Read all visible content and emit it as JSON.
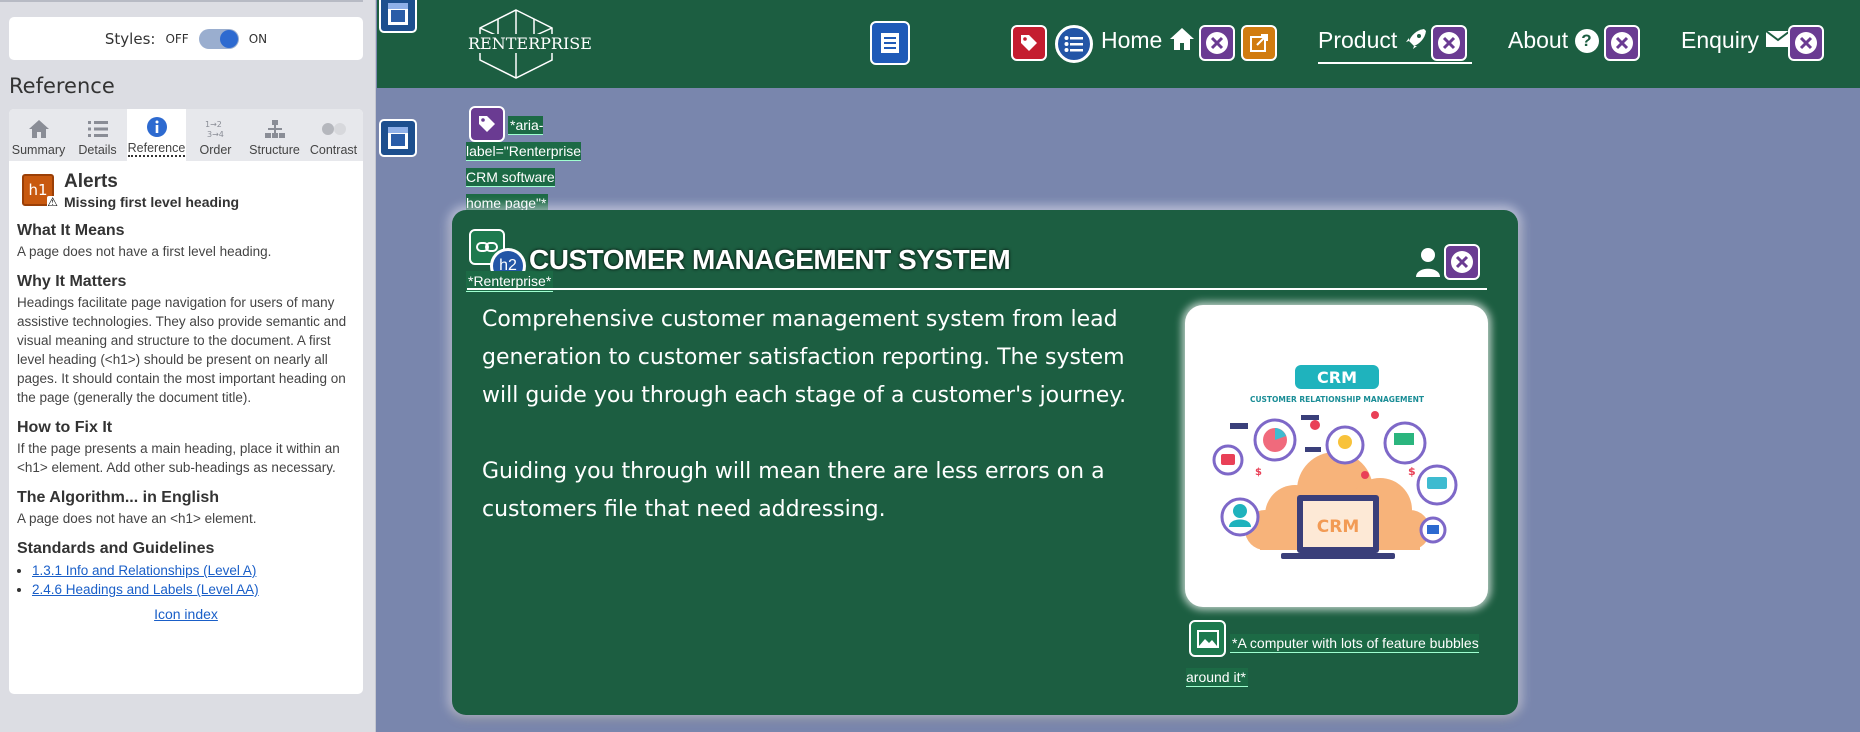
{
  "panel": {
    "styles_label": "Styles:",
    "styles_off": "OFF",
    "styles_on": "ON",
    "reference_heading": "Reference",
    "tabs": [
      {
        "label": "Summary",
        "icon": "home-icon"
      },
      {
        "label": "Details",
        "icon": "list-icon"
      },
      {
        "label": "Reference",
        "icon": "info-icon",
        "active": true
      },
      {
        "label": "Order",
        "icon": "order-icon"
      },
      {
        "label": "Structure",
        "icon": "structure-icon"
      },
      {
        "label": "Contrast",
        "icon": "contrast-icon"
      }
    ],
    "alert": {
      "badge": "h1",
      "title": "Alerts",
      "subtitle": "Missing first level heading"
    },
    "sections": [
      {
        "heading": "What It Means",
        "text": "A page does not have a first level heading."
      },
      {
        "heading": "Why It Matters",
        "text": "Headings facilitate page navigation for users of many assistive technologies. They also provide semantic and visual meaning and structure to the document. A first level heading (<h1>) should be present on nearly all pages. It should contain the most important heading on the page (generally the document title)."
      },
      {
        "heading": "How to Fix It",
        "text": "If the page presents a main heading, place it within an <h1> element. Add other sub-headings as necessary."
      },
      {
        "heading": "The Algorithm... in English",
        "text": "A page does not have an <h1> element."
      }
    ],
    "standards_heading": "Standards and Guidelines",
    "standards": [
      "1.3.1 Info and Relationships (Level A)",
      "2.4.6 Headings and Labels (Level AA)"
    ],
    "icon_index": "Icon index"
  },
  "site": {
    "logo_text": "RENTERPRISE",
    "nav": {
      "home": "Home",
      "product": "Product",
      "about": "About",
      "about_icon": "?",
      "enquiry": "Enquiry"
    },
    "aria_label": "*aria-label=\"Renterprise CRM software home page\"*",
    "link_text": "*Renterprise*",
    "h2_badge": "h2",
    "card_title": "CUSTOMER MANAGEMENT SYSTEM",
    "para1": "Comprehensive customer management system from lead generation to customer satisfaction reporting. The system will guide you through each stage of a customer's journey.",
    "para2": "Guiding you through will mean there are less errors on a customers file that need addressing.",
    "img_alt": "*A computer with lots of feature bubbles around it*",
    "crm_image": {
      "title": "CRM",
      "subtitle": "CUSTOMER RELATIONSHIP MANAGEMENT",
      "screen_text": "CRM"
    }
  },
  "colors": {
    "header_green": "#1c5e41",
    "page_bg": "#7986ad",
    "purple_badge": "#6a3b92",
    "link_blue": "#1a5fc8"
  }
}
